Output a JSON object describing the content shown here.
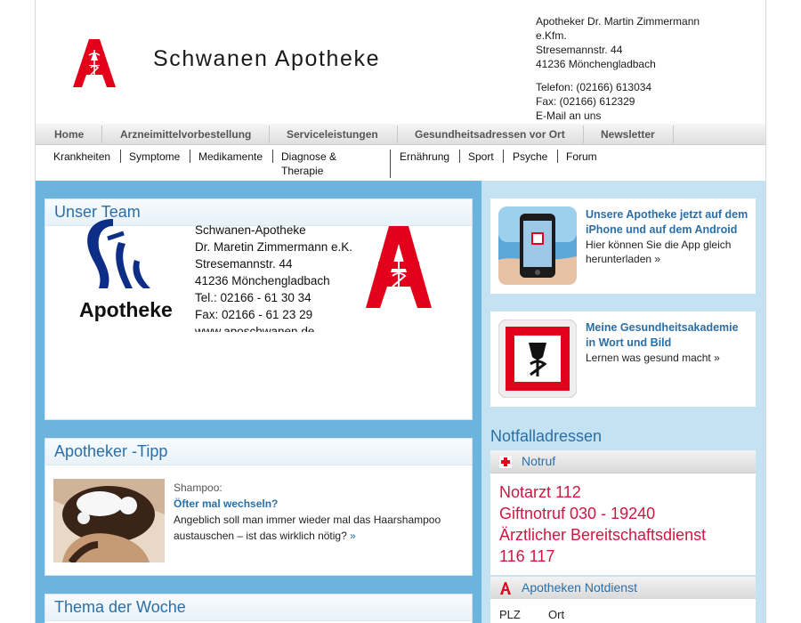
{
  "header": {
    "site_title": "Schwanen Apotheke",
    "contact": {
      "line1": "Apotheker Dr. Martin Zimmermann",
      "line2": "e.Kfm.",
      "street": "Stresemannstr. 44",
      "city": "41236 Mönchengladbach",
      "phone": "Telefon: (02166) 613034",
      "fax": "Fax: (02166) 612329",
      "email": "E-Mail an uns"
    }
  },
  "main_nav": [
    "Home",
    "Arzneimittelvorbestellung",
    "Serviceleistungen",
    "Gesundheitsadressen vor Ort",
    "Newsletter"
  ],
  "sub_nav": {
    "items": [
      "Krankheiten",
      "Symptome",
      "Medikamente",
      "Ernährung",
      "Sport",
      "Psyche",
      "Forum"
    ],
    "diagnose_line1": "Diagnose &",
    "diagnose_line2": "Therapie"
  },
  "team": {
    "heading": "Unser Team",
    "card": {
      "word": "Apotheke",
      "l1": "Schwanen-Apotheke",
      "l2": "Dr. Maretin Zimmermann e.K.",
      "l3": "Stresemannstr. 44",
      "l4": "41236 Mönchengladbach",
      "l5": "Tel.: 02166 - 61 30 34",
      "l6": "Fax: 02166 - 61 23 29",
      "l7": "www.aposchwanen.de"
    }
  },
  "tipp": {
    "heading": "Apotheker -Tipp",
    "category": "Shampoo:",
    "title": "Öfter mal wechseln?",
    "text": "Angeblich soll man immer wieder mal das Haarshampoo austauschen – ist das wirklich nötig?",
    "more": "»"
  },
  "thema": {
    "heading": "Thema der Woche"
  },
  "promo_app": {
    "title": "Unsere Apotheke jetzt auf dem iPhone und auf dem Android",
    "text": "Hier können Sie die App gleich herunterladen »"
  },
  "promo_akademie": {
    "title": "Meine Gesundheitsakademie in Wort und Bild",
    "text": "Lernen was gesund macht »"
  },
  "notfall": {
    "heading": "Notfalladressen",
    "notruf_label": "Notruf",
    "lines": [
      "Notarzt 112",
      "Giftnotruf 030 - 19240",
      "Ärztlicher Bereitschaftsdienst",
      "116 117"
    ],
    "notdienst_label": "Apotheken Notdienst",
    "col_plz": "PLZ",
    "col_ort": "Ort"
  },
  "colors": {
    "brand_red": "#e2001a",
    "link_blue": "#2a6fa8",
    "emergency_red": "#d01642",
    "left_bg": "#6cb4dd",
    "right_bg": "#c5e2f3"
  }
}
